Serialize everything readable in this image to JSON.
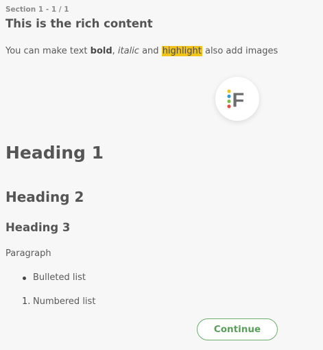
{
  "section_label": "Section 1 - 1 / 1",
  "title": "This is the rich content",
  "intro": {
    "part1": "You can make text ",
    "bold": "bold",
    "part2": ", ",
    "italic": "italic",
    "part3": " and ",
    "highlight": "highlight",
    "part4": " also add images"
  },
  "logo": {
    "icon": "f-logo-icon",
    "letter": "F",
    "dot_colors": [
      "#f2c419",
      "#2c9ad7",
      "#7ac143",
      "#e84c3d"
    ]
  },
  "heading1": "Heading 1",
  "heading2": "Heading 2",
  "heading3": "Heading 3",
  "paragraph": "Paragraph",
  "bulleted_list": [
    "Bulleted list"
  ],
  "numbered_list": {
    "markers": [
      "1."
    ],
    "items": [
      "Numbered list"
    ]
  },
  "continue_button": "Continue",
  "colors": {
    "highlight": "#f2c419",
    "button_accent": "#5a9e5a"
  }
}
